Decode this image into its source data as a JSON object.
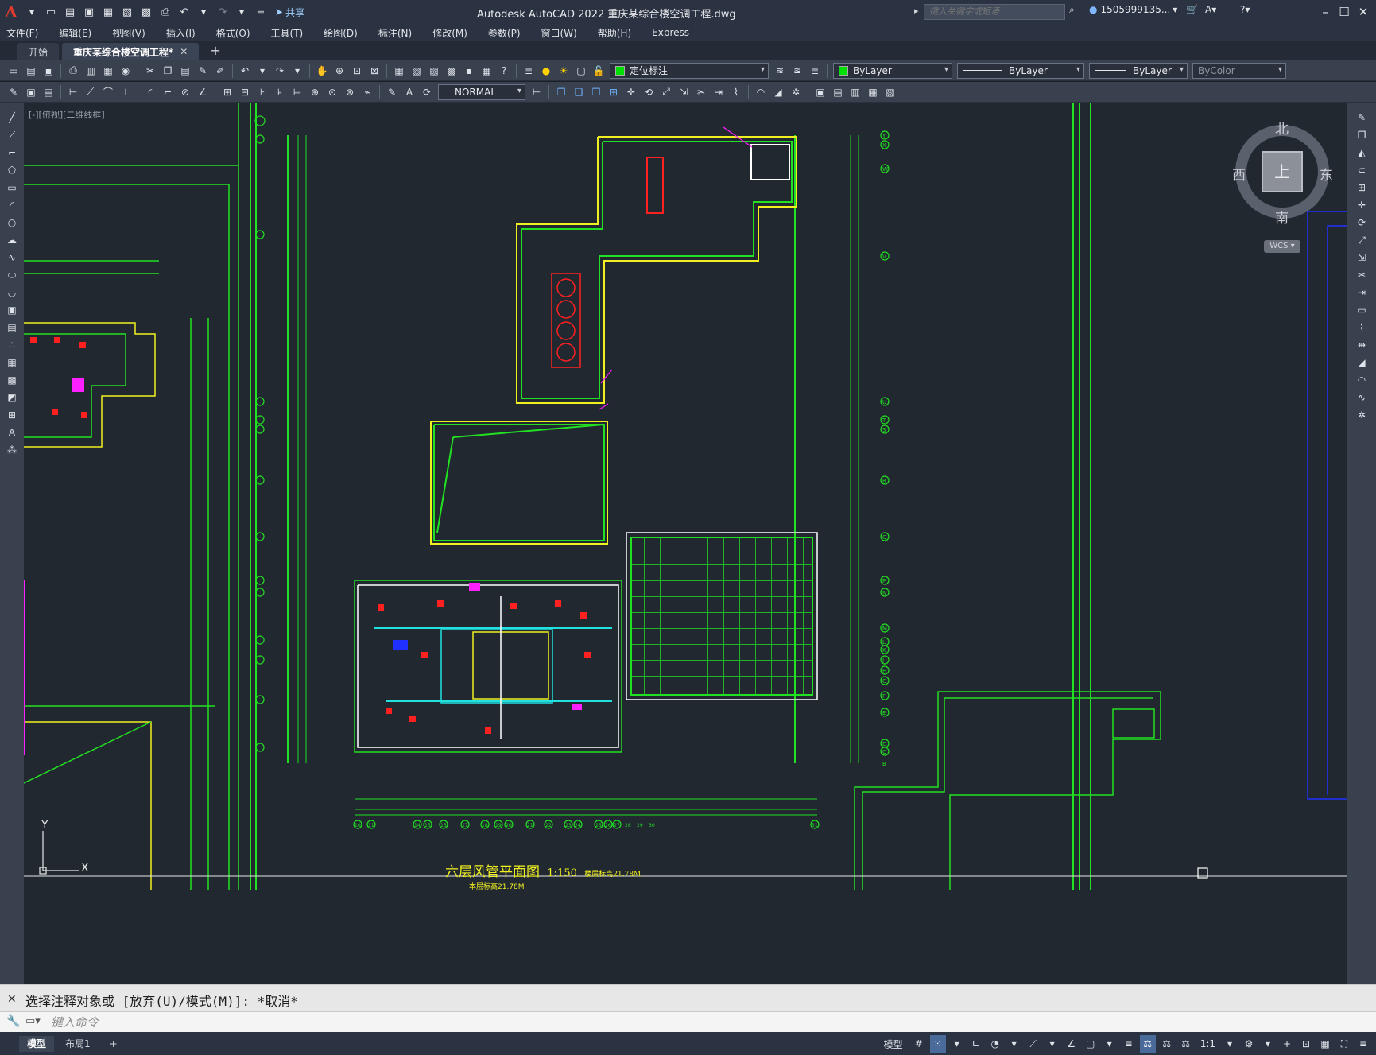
{
  "titlebar": {
    "app_logo": "A",
    "share_label": "共享",
    "title": "Autodesk AutoCAD 2022    重庆某综合楼空调工程.dwg",
    "search_placeholder": "键入关键字或短语",
    "user": "1505999135...",
    "quick_access": [
      "new-icon",
      "open-icon",
      "save-icon",
      "saveas-icon",
      "publish-icon",
      "plot-icon",
      "print-icon",
      "undo-icon",
      "redo-icon",
      "customize-icon"
    ]
  },
  "menubar": {
    "items": [
      "文件(F)",
      "编辑(E)",
      "视图(V)",
      "插入(I)",
      "格式(O)",
      "工具(T)",
      "绘图(D)",
      "标注(N)",
      "修改(M)",
      "参数(P)",
      "窗口(W)",
      "帮助(H)",
      "Express"
    ]
  },
  "tabs": {
    "items": [
      {
        "label": "开始",
        "active": false
      },
      {
        "label": "重庆某综合楼空调工程*",
        "active": true
      }
    ],
    "add_label": "+"
  },
  "toolbar1": {
    "layer_dropdown": "定位标注",
    "color_dropdown": "ByLayer",
    "linetype_dropdown": "ByLayer",
    "lineweight_dropdown": "ByLayer",
    "plotstyle_dropdown": "ByColor"
  },
  "toolbar2": {
    "dimstyle_dropdown": "NORMAL"
  },
  "viewport": {
    "label": "[-][俯视][二维线框]"
  },
  "viewcube": {
    "north": "北",
    "south": "南",
    "east": "东",
    "west": "西",
    "face": "上",
    "wcs": "WCS"
  },
  "drawing": {
    "title": "六层风管平面图",
    "scale": "1:150",
    "note": "本层标高21.78M",
    "elevation_note": "楼层标高21.78M",
    "axis_letters_right": [
      "Y",
      "X",
      "W",
      "V",
      "U",
      "T",
      "S",
      "R",
      "Q",
      "P",
      "N",
      "M",
      "L",
      "K",
      "J",
      "H",
      "G",
      "F",
      "E",
      "D",
      "C",
      "B"
    ],
    "axis_numbers_bottom": [
      "10",
      "11",
      "14",
      "15",
      "16",
      "17",
      "18",
      "19",
      "20",
      "21",
      "22",
      "23",
      "24",
      "25",
      "26",
      "27",
      "28",
      "29",
      "30",
      "31"
    ]
  },
  "commandline": {
    "history": "选择注释对象或 [放弃(U)/模式(M)]: *取消*",
    "input_placeholder": "键入命令"
  },
  "statusbar": {
    "tabs": [
      "模型",
      "布局1"
    ],
    "add_label": "+",
    "model_label": "模型",
    "scale_label": "1:1"
  },
  "colors": {
    "background": "#212830",
    "green_lines": "#22e022",
    "yellow_lines": "#f0f020",
    "red_equipment": "#ff2020",
    "magenta_notes": "#ff20ff",
    "cyan_ducts": "#20e0e0",
    "blue_frame": "#2030ff"
  }
}
